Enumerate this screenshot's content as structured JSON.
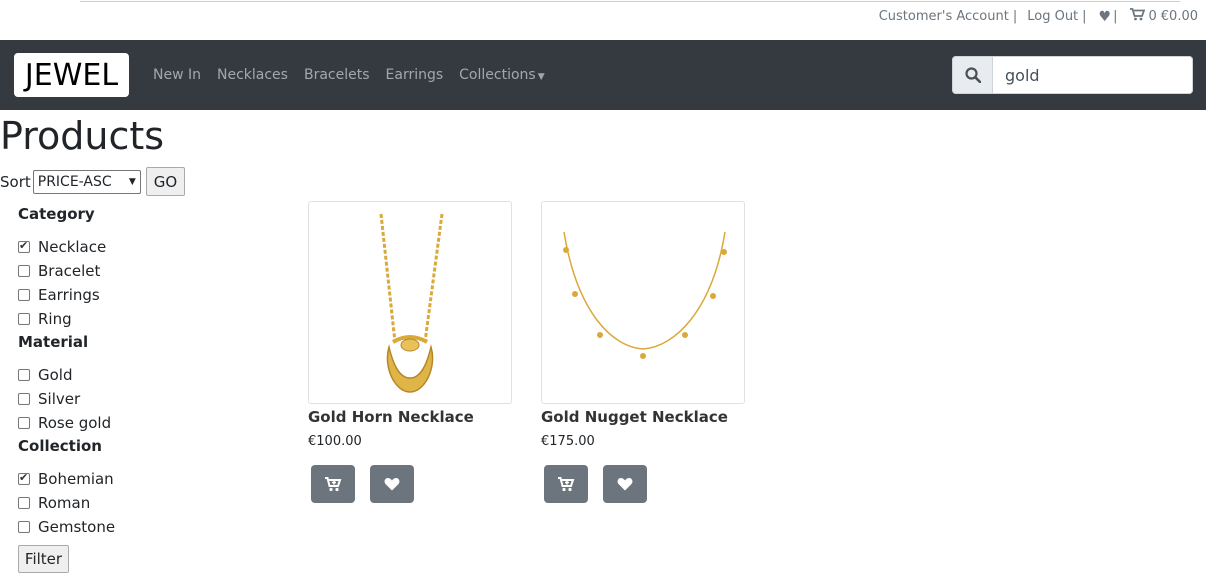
{
  "topbar": {
    "account": "Customer's Account",
    "logout": "Log Out",
    "cart_count": "0",
    "cart_total": "€0.00"
  },
  "brand": "JEWEL",
  "nav": {
    "items": [
      "New In",
      "Necklaces",
      "Bracelets",
      "Earrings",
      "Collections"
    ]
  },
  "search": {
    "value": "gold"
  },
  "page_title": "Products",
  "sort": {
    "label": "Sort",
    "selected": "PRICE-ASC",
    "go_label": "GO"
  },
  "filters": {
    "category_heading": "Category",
    "category_options": [
      {
        "label": "Necklace",
        "checked": true
      },
      {
        "label": "Bracelet",
        "checked": false
      },
      {
        "label": "Earrings",
        "checked": false
      },
      {
        "label": "Ring",
        "checked": false
      }
    ],
    "material_heading": "Material",
    "material_options": [
      {
        "label": "Gold",
        "checked": false
      },
      {
        "label": "Silver",
        "checked": false
      },
      {
        "label": "Rose gold",
        "checked": false
      }
    ],
    "collection_heading": "Collection",
    "collection_options": [
      {
        "label": "Bohemian",
        "checked": true
      },
      {
        "label": "Roman",
        "checked": false
      },
      {
        "label": "Gemstone",
        "checked": false
      }
    ],
    "filter_label": "Filter"
  },
  "products": [
    {
      "name": "Gold Horn Necklace",
      "price": "€100.00",
      "icons": [
        "cart-plus-icon",
        "heart-icon"
      ]
    },
    {
      "name": "Gold Nugget Necklace",
      "price": "€175.00",
      "icons": [
        "cart-plus-icon",
        "heart-icon"
      ]
    }
  ],
  "colors": {
    "navbar": "#343a40",
    "button": "#6c757d",
    "gold": "#d9a93a"
  }
}
